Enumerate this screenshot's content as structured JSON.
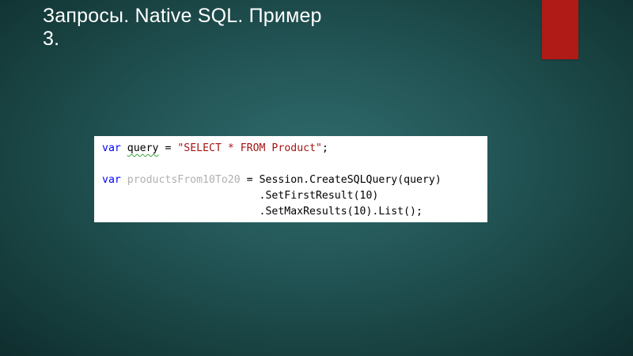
{
  "slide": {
    "title_line1": "Запросы. Native SQL. Пример",
    "title_line2": "3."
  },
  "code": {
    "line1": {
      "keyword": "var",
      "variable": "query",
      "op": "=",
      "string": "\"SELECT * FROM Product\"",
      "end": ";"
    },
    "line2": {
      "keyword": "var",
      "variable": "productsFrom10To20",
      "op": "=",
      "call": "Session.CreateSQLQuery(query)"
    },
    "line3": ".SetFirstResult(10)",
    "line4": ".SetMaxResults(10).List();"
  },
  "colors": {
    "accent_red": "#b01a17",
    "keyword_blue": "#0000ff",
    "string_red": "#a31515",
    "background_teal": "#245758"
  }
}
